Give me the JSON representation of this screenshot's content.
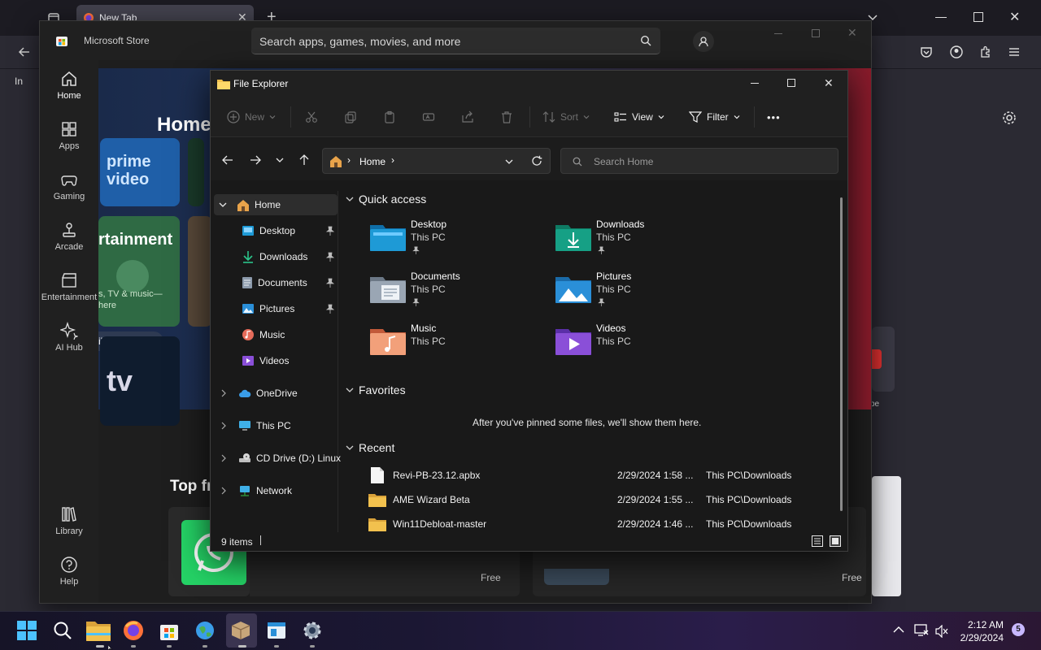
{
  "browser": {
    "tab_title": "New Tab",
    "nav_left_label": "In",
    "right_partial_label": "pe"
  },
  "store": {
    "title": "Microsoft Store",
    "search_placeholder": "Search apps, games, movies, and more",
    "nav": [
      {
        "label": "Home",
        "icon": "home-icon"
      },
      {
        "label": "Apps",
        "icon": "apps-icon"
      },
      {
        "label": "Gaming",
        "icon": "gamepad-icon"
      },
      {
        "label": "Arcade",
        "icon": "joystick-icon"
      },
      {
        "label": "Entertainment",
        "icon": "clapper-icon"
      },
      {
        "label": "AI Hub",
        "icon": "sparkle-icon"
      },
      {
        "label": "Library",
        "icon": "library-icon"
      },
      {
        "label": "Help",
        "icon": "help-icon"
      }
    ],
    "home_heading": "Home",
    "entertainment_text": "rtainment",
    "entertainment_sub": "s, TV & music—",
    "entertainment_sub2": "here",
    "details_label": "ils",
    "top_free_heading": "Top free ap",
    "free_label_1": "Free",
    "free_label_2": "Free",
    "prime_text": "prime video",
    "appletv_text": "tv"
  },
  "explorer": {
    "title": "File Explorer",
    "toolbar": {
      "new_label": "New",
      "sort_label": "Sort",
      "view_label": "View",
      "filter_label": "Filter",
      "more_label": "•••"
    },
    "address": {
      "location": "Home"
    },
    "search_placeholder": "Search Home",
    "sidebar": [
      {
        "label": "Home",
        "icon": "home-icon",
        "selected": true,
        "expander": true
      },
      {
        "label": "Desktop",
        "icon": "desktop-folder-icon",
        "pinned": true
      },
      {
        "label": "Downloads",
        "icon": "download-icon",
        "pinned": true
      },
      {
        "label": "Documents",
        "icon": "documents-icon",
        "pinned": true
      },
      {
        "label": "Pictures",
        "icon": "pictures-icon",
        "pinned": true
      },
      {
        "label": "Music",
        "icon": "music-icon"
      },
      {
        "label": "Videos",
        "icon": "videos-icon"
      },
      {
        "label": "OneDrive",
        "icon": "cloud-icon",
        "expander": true
      },
      {
        "label": "This PC",
        "icon": "monitor-icon",
        "expander": true
      },
      {
        "label": "CD Drive (D:) Linux l",
        "icon": "cd-drive-icon",
        "expander": true
      },
      {
        "label": "Network",
        "icon": "network-icon",
        "expander": true
      }
    ],
    "quick_access_heading": "Quick access",
    "quick_access": [
      {
        "name": "Desktop",
        "sub": "This PC",
        "pinned": true,
        "color": "#1e9ad6"
      },
      {
        "name": "Downloads",
        "sub": "This PC",
        "pinned": true,
        "color": "#16a085"
      },
      {
        "name": "Documents",
        "sub": "This PC",
        "pinned": true,
        "color": "#8c9aab"
      },
      {
        "name": "Pictures",
        "sub": "This PC",
        "pinned": true,
        "color": "#2a8fd8"
      },
      {
        "name": "Music",
        "sub": "This PC",
        "pinned": false,
        "color": "#e56b5a"
      },
      {
        "name": "Videos",
        "sub": "This PC",
        "pinned": false,
        "color": "#8a4fd8"
      }
    ],
    "favorites_heading": "Favorites",
    "favorites_empty": "After you've pinned some files, we'll show them here.",
    "recent_heading": "Recent",
    "recent": [
      {
        "name": "Revi-PB-23.12.apbx",
        "date": "2/29/2024 1:58 ...",
        "location": "This PC\\Downloads",
        "type": "file"
      },
      {
        "name": "AME Wizard Beta",
        "date": "2/29/2024 1:55 ...",
        "location": "This PC\\Downloads",
        "type": "folder"
      },
      {
        "name": "Win11Debloat-master",
        "date": "2/29/2024 1:46 ...",
        "location": "This PC\\Downloads",
        "type": "folder"
      }
    ],
    "status": {
      "items": "9 items"
    }
  },
  "taskbar": {
    "time": "2:12 AM",
    "date": "2/29/2024",
    "notification_count": "5"
  },
  "colors": {
    "accent": "#4cc2ff",
    "folder_yellow": "#f2c14e",
    "store_bg": "#202020",
    "explorer_bg": "#191919"
  }
}
